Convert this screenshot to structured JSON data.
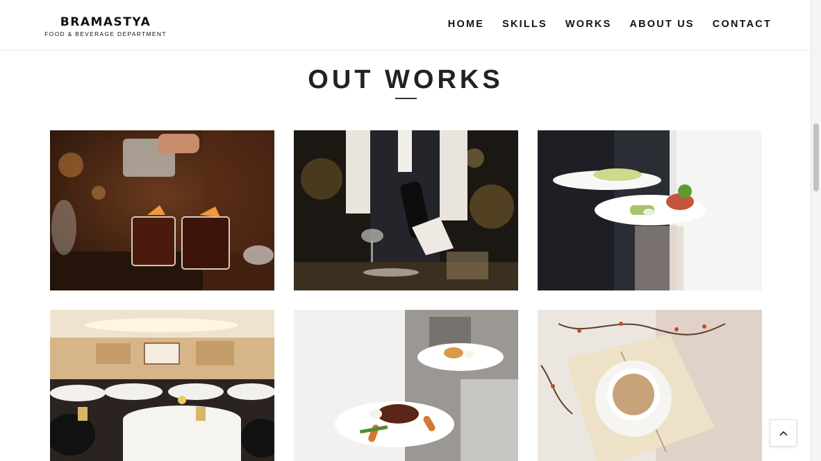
{
  "brand": {
    "name": "BRAMASTYA",
    "tagline": "FOOD & BEVERAGE DEPARTMENT"
  },
  "nav": [
    {
      "label": "HOME"
    },
    {
      "label": "SKILLS"
    },
    {
      "label": "WORKS"
    },
    {
      "label": "ABOUT US"
    },
    {
      "label": "CONTACT"
    }
  ],
  "works": {
    "title": "OUT WORKS",
    "images": [
      {
        "subject": "bartender pouring cocktails"
      },
      {
        "subject": "waiter presenting wine bottle"
      },
      {
        "subject": "server carrying plated dishes"
      },
      {
        "subject": "banquet hall with round tables"
      },
      {
        "subject": "chef holding plated steak dishes"
      },
      {
        "subject": "cup of tea on open book"
      }
    ]
  },
  "ui": {
    "back_to_top_icon": "chevron-up-icon"
  }
}
